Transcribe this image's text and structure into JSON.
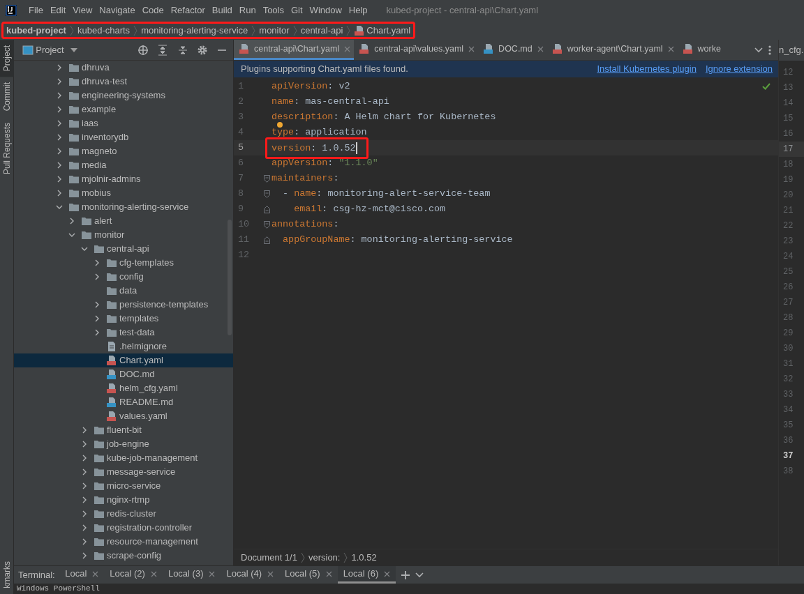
{
  "window": {
    "title": "kubed-project - central-api\\Chart.yaml"
  },
  "menu": [
    "File",
    "Edit",
    "View",
    "Navigate",
    "Code",
    "Refactor",
    "Build",
    "Run",
    "Tools",
    "Git",
    "Window",
    "Help"
  ],
  "breadcrumb": {
    "highlighted": true,
    "items": [
      {
        "label": "kubed-project",
        "kind": "project"
      },
      {
        "label": "kubed-charts",
        "kind": "folder"
      },
      {
        "label": "monitoring-alerting-service",
        "kind": "folder"
      },
      {
        "label": "monitor",
        "kind": "folder"
      },
      {
        "label": "central-api",
        "kind": "folder"
      },
      {
        "label": "Chart.yaml",
        "kind": "yaml"
      }
    ]
  },
  "tool_strip": {
    "top": [
      {
        "label": "Project",
        "selected": true
      },
      {
        "label": "Commit",
        "selected": false
      },
      {
        "label": "Pull Requests",
        "selected": false
      }
    ],
    "bottom": [
      {
        "label": "kmarks",
        "selected": false
      }
    ]
  },
  "project_panel": {
    "title": "Project",
    "tree": [
      {
        "label": "dhruva",
        "kind": "folder",
        "expanded": false,
        "selected": false
      },
      {
        "label": "dhruva-test",
        "kind": "folder",
        "expanded": false,
        "selected": false
      },
      {
        "label": "engineering-systems",
        "kind": "folder",
        "expanded": false,
        "selected": false
      },
      {
        "label": "example",
        "kind": "folder",
        "expanded": false,
        "selected": false
      },
      {
        "label": "iaas",
        "kind": "folder",
        "expanded": false,
        "selected": false
      },
      {
        "label": "inventorydb",
        "kind": "folder",
        "expanded": false,
        "selected": false
      },
      {
        "label": "magneto",
        "kind": "folder",
        "expanded": false,
        "selected": false
      },
      {
        "label": "media",
        "kind": "folder",
        "expanded": false,
        "selected": false
      },
      {
        "label": "mjolnir-admins",
        "kind": "folder",
        "expanded": false,
        "selected": false
      },
      {
        "label": "mobius",
        "kind": "folder",
        "expanded": false,
        "selected": false
      },
      {
        "label": "monitoring-alerting-service",
        "kind": "folder",
        "expanded": true,
        "selected": false,
        "children": [
          {
            "label": "alert",
            "kind": "folder",
            "expanded": false,
            "selected": false
          },
          {
            "label": "monitor",
            "kind": "folder",
            "expanded": true,
            "selected": false,
            "children": [
              {
                "label": "central-api",
                "kind": "folder",
                "expanded": true,
                "selected": false,
                "children": [
                  {
                    "label": "cfg-templates",
                    "kind": "folder",
                    "expanded": false,
                    "selected": false
                  },
                  {
                    "label": "config",
                    "kind": "folder",
                    "expanded": false,
                    "selected": false
                  },
                  {
                    "label": "data",
                    "kind": "folder",
                    "selected": false
                  },
                  {
                    "label": "persistence-templates",
                    "kind": "folder",
                    "expanded": false,
                    "selected": false
                  },
                  {
                    "label": "templates",
                    "kind": "folder",
                    "expanded": false,
                    "selected": false
                  },
                  {
                    "label": "test-data",
                    "kind": "folder",
                    "expanded": false,
                    "selected": false
                  },
                  {
                    "label": ".helmignore",
                    "kind": "text",
                    "selected": false
                  },
                  {
                    "label": "Chart.yaml",
                    "kind": "yaml",
                    "selected": true
                  },
                  {
                    "label": "DOC.md",
                    "kind": "markdown",
                    "selected": false
                  },
                  {
                    "label": "helm_cfg.yaml",
                    "kind": "yaml",
                    "selected": false
                  },
                  {
                    "label": "README.md",
                    "kind": "markdown",
                    "selected": false
                  },
                  {
                    "label": "values.yaml",
                    "kind": "yaml",
                    "selected": false
                  }
                ]
              },
              {
                "label": "fluent-bit",
                "kind": "folder",
                "expanded": false,
                "selected": false
              },
              {
                "label": "job-engine",
                "kind": "folder",
                "expanded": false,
                "selected": false
              },
              {
                "label": "kube-job-management",
                "kind": "folder",
                "expanded": false,
                "selected": false
              },
              {
                "label": "message-service",
                "kind": "folder",
                "expanded": false,
                "selected": false
              },
              {
                "label": "micro-service",
                "kind": "folder",
                "expanded": false,
                "selected": false
              },
              {
                "label": "nginx-rtmp",
                "kind": "folder",
                "expanded": false,
                "selected": false
              },
              {
                "label": "redis-cluster",
                "kind": "folder",
                "expanded": false,
                "selected": false
              },
              {
                "label": "registration-controller",
                "kind": "folder",
                "expanded": false,
                "selected": false
              },
              {
                "label": "resource-management",
                "kind": "folder",
                "expanded": false,
                "selected": false
              },
              {
                "label": "scrape-config",
                "kind": "folder",
                "expanded": false,
                "selected": false
              }
            ]
          }
        ]
      }
    ]
  },
  "editor": {
    "tabs": [
      {
        "label": "central-api\\Chart.yaml",
        "kind": "yaml",
        "selected": true,
        "closable": true
      },
      {
        "label": "central-api\\values.yaml",
        "kind": "yaml",
        "selected": false,
        "closable": true
      },
      {
        "label": "DOC.md",
        "kind": "markdown",
        "selected": false,
        "closable": true
      },
      {
        "label": "worker-agent\\Chart.yaml",
        "kind": "yaml",
        "selected": false,
        "closable": true
      },
      {
        "label": "worke",
        "kind": "yaml",
        "selected": false,
        "closable": false
      }
    ],
    "banner": {
      "message": "Plugins supporting Chart.yaml files found.",
      "links": [
        "Install Kubernetes plugin",
        "Ignore extension"
      ]
    },
    "analysis_ok": true,
    "lines": [
      {
        "number": "1",
        "current": false,
        "segments": [
          {
            "kind": "key",
            "text": "apiVersion"
          },
          {
            "kind": "plain",
            "text": ": v2"
          }
        ]
      },
      {
        "number": "2",
        "current": false,
        "segments": [
          {
            "kind": "key",
            "text": "name"
          },
          {
            "kind": "plain",
            "text": ": mas-central-api"
          }
        ]
      },
      {
        "number": "3",
        "current": false,
        "segments": [
          {
            "kind": "key",
            "text": "description"
          },
          {
            "kind": "plain",
            "text": ": A Helm chart for Kubernetes"
          }
        ]
      },
      {
        "number": "4",
        "current": false,
        "bulb": true,
        "segments": [
          {
            "kind": "key",
            "text": "type"
          },
          {
            "kind": "plain",
            "text": ": application"
          }
        ]
      },
      {
        "number": "5",
        "current": true,
        "highlighted": true,
        "caret": true,
        "segments": [
          {
            "kind": "key",
            "text": "version"
          },
          {
            "kind": "plain",
            "text": ": 1.0.52"
          }
        ]
      },
      {
        "number": "6",
        "current": false,
        "segments": [
          {
            "kind": "key",
            "text": "appVersion"
          },
          {
            "kind": "plain",
            "text": ": "
          },
          {
            "kind": "string",
            "text": "\"1.1.0\""
          }
        ]
      },
      {
        "number": "7",
        "current": false,
        "kind": "fold_start",
        "segments": [
          {
            "kind": "key",
            "text": "maintainers"
          },
          {
            "kind": "plain",
            "text": ":"
          }
        ]
      },
      {
        "number": "8",
        "current": false,
        "kind": "fold_start",
        "segments": [
          {
            "kind": "plain",
            "text": "  - "
          },
          {
            "kind": "key",
            "text": "name"
          },
          {
            "kind": "plain",
            "text": ": monitoring-alert-service-team"
          }
        ]
      },
      {
        "number": "9",
        "current": false,
        "kind": "fold_end",
        "segments": [
          {
            "kind": "key",
            "text": "    email"
          },
          {
            "kind": "plain",
            "text": ": csg-hz-mct@cisco.com"
          }
        ]
      },
      {
        "number": "10",
        "current": false,
        "kind": "fold_start",
        "segments": [
          {
            "kind": "key",
            "text": "annotations"
          },
          {
            "kind": "plain",
            "text": ":"
          }
        ]
      },
      {
        "number": "11",
        "current": false,
        "kind": "fold_end",
        "segments": [
          {
            "kind": "key",
            "text": "  appGroupName"
          },
          {
            "kind": "plain",
            "text": ": monitoring-alerting-service"
          }
        ]
      },
      {
        "number": "12",
        "current": false
      }
    ],
    "status_path": [
      "Document 1/1",
      "version:",
      "1.0.52"
    ]
  },
  "side_editor": {
    "tab": "n_cfg.",
    "lines": [
      {
        "number": "12",
        "current": false
      },
      {
        "number": "13",
        "current": false
      },
      {
        "number": "14",
        "current": false
      },
      {
        "number": "15",
        "current": false
      },
      {
        "number": "16",
        "current": false
      },
      {
        "number": "17",
        "current": true
      },
      {
        "number": "18",
        "current": false
      },
      {
        "number": "19",
        "current": false
      },
      {
        "number": "20",
        "current": false
      },
      {
        "number": "21",
        "current": false
      },
      {
        "number": "22",
        "current": false
      },
      {
        "number": "23",
        "current": false
      },
      {
        "number": "24",
        "current": false
      },
      {
        "number": "25",
        "current": false
      },
      {
        "number": "26",
        "current": false
      },
      {
        "number": "27",
        "current": false
      },
      {
        "number": "28",
        "current": false
      },
      {
        "number": "29",
        "current": false
      },
      {
        "number": "30",
        "current": false
      },
      {
        "number": "31",
        "current": false
      },
      {
        "number": "32",
        "current": false
      },
      {
        "number": "33",
        "current": false
      },
      {
        "number": "34",
        "current": false
      },
      {
        "number": "35",
        "current": false
      },
      {
        "number": "36",
        "current": false
      },
      {
        "number": "37",
        "current": false,
        "bold": true
      },
      {
        "number": "38",
        "current": false
      }
    ]
  },
  "terminal": {
    "label": "Terminal:",
    "tabs": [
      {
        "label": "Local",
        "selected": false
      },
      {
        "label": "Local (2)",
        "selected": false
      },
      {
        "label": "Local (3)",
        "selected": false
      },
      {
        "label": "Local (4)",
        "selected": false
      },
      {
        "label": "Local (5)",
        "selected": false
      },
      {
        "label": "Local (6)",
        "selected": true
      }
    ],
    "output": "Windows PowerShell"
  }
}
